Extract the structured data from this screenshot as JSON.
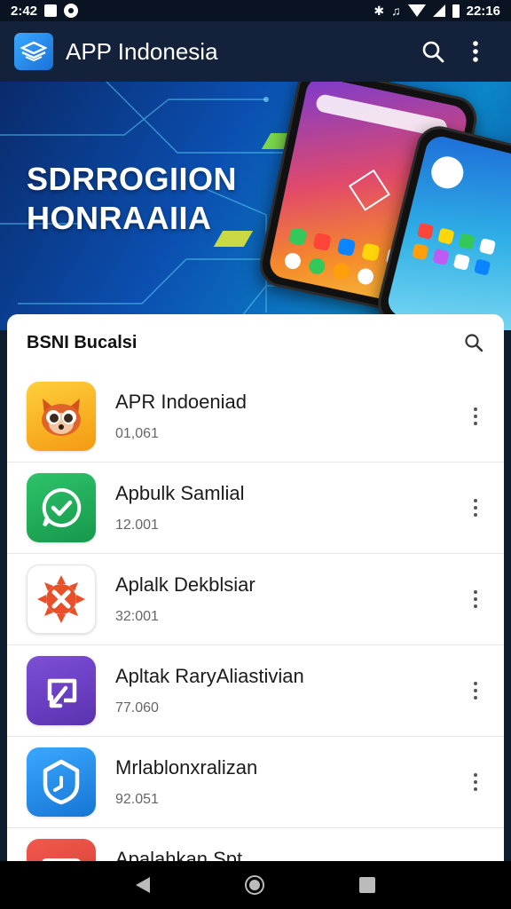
{
  "status_bar": {
    "time_left": "2:42",
    "time_right": "22:16"
  },
  "app_bar": {
    "title": "APP Indonesia",
    "icons": [
      "app-logo-icon",
      "search-icon",
      "more-vertical-icon"
    ]
  },
  "banner": {
    "heading": "SDRROGIION\nHONRAAIIA"
  },
  "list": {
    "title": "BSNI Bucalsi",
    "items": [
      {
        "name": "APR Indoeniad",
        "meta": "01,061",
        "icon": "raccoon-icon",
        "color": "#f6a21d"
      },
      {
        "name": "Apbulk Samlial",
        "meta": "12.001",
        "icon": "chat-check-icon",
        "color": "#1faa59"
      },
      {
        "name": "Aplalk Dekblsiar",
        "meta": "32:001",
        "icon": "gear-x-icon",
        "color": "#e8502a"
      },
      {
        "name": "Apltak RaryAliastivian",
        "meta": "77.060",
        "icon": "share-arrow-icon",
        "color": "#6a3fc2"
      },
      {
        "name": "Mrlablonxralizan",
        "meta": "92.051",
        "icon": "shield-clock-icon",
        "color": "#2495e8"
      },
      {
        "name": "Apalahkan Spt",
        "meta": "",
        "icon": "mail-icon",
        "color": "#e2433b"
      }
    ]
  },
  "nav_bar": {
    "icons": [
      "back-icon",
      "home-icon",
      "recent-apps-icon"
    ]
  }
}
